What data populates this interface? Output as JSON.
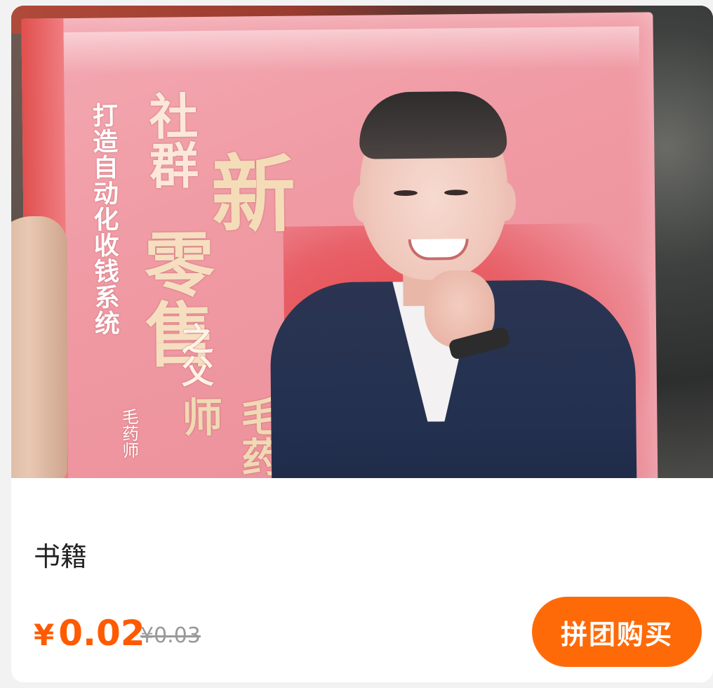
{
  "product": {
    "image_alt": "book cover photo",
    "cover": {
      "slogan": "打造自动化收钱系统",
      "title_she_qun": "社群",
      "title_xin": "新",
      "title_ling_shou": "零售",
      "subtitle": "之父",
      "name": "毛药师",
      "author_credit": "毛药师 著"
    },
    "title": "书籍",
    "price": {
      "currency": "¥",
      "current": "0.02",
      "original": "¥0.03"
    },
    "buy_button_label": "拼团购买"
  },
  "colors": {
    "accent": "#ff5a00",
    "button": "#ff6a08",
    "original_price": "#999999"
  }
}
